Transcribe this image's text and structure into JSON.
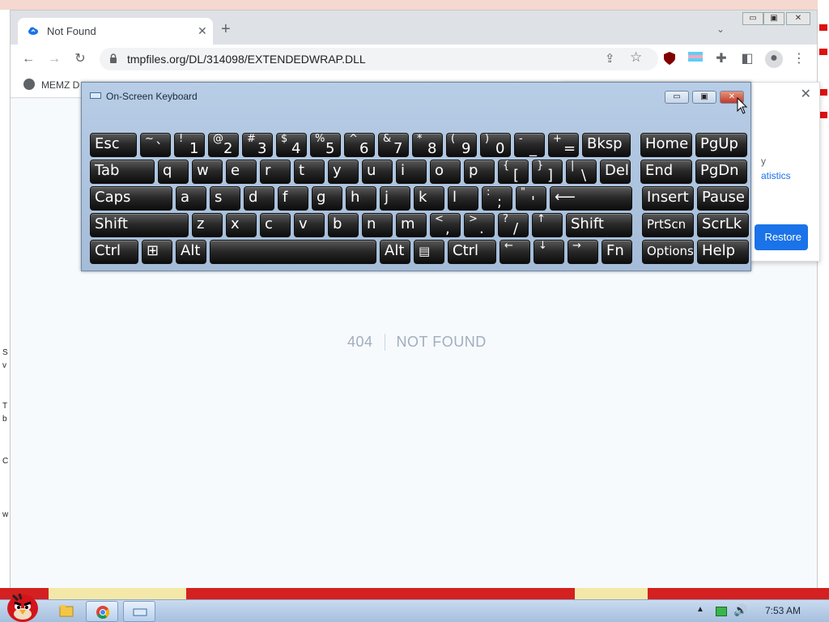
{
  "browser": {
    "tab_title": "Not Found",
    "tab_close": "✕",
    "new_tab": "+",
    "tab_search": "⌄",
    "url": "tmpfiles.org/DL/314098/EXTENDEDWRAP.DLL",
    "bookmark": "MEMZ D",
    "window_controls": [
      "▭",
      "▣",
      "✕"
    ]
  },
  "page": {
    "code": "404",
    "message": "NOT FOUND"
  },
  "popup": {
    "line1": "y",
    "line2": "atistics",
    "close": "✕",
    "restore_label": "Restore"
  },
  "osk": {
    "title": "On-Screen Keyboard",
    "controls": [
      "▭",
      "▣",
      "✕"
    ],
    "rows": [
      [
        {
          "m": "Esc",
          "w": 58
        },
        {
          "s": "~",
          "p": "`",
          "w": 38
        },
        {
          "s": "!",
          "p": "1",
          "w": 38
        },
        {
          "s": "@",
          "p": "2",
          "w": 38
        },
        {
          "s": "#",
          "p": "3",
          "w": 38
        },
        {
          "s": "$",
          "p": "4",
          "w": 38
        },
        {
          "s": "%",
          "p": "5",
          "w": 38
        },
        {
          "s": "^",
          "p": "6",
          "w": 38
        },
        {
          "s": "&",
          "p": "7",
          "w": 38
        },
        {
          "s": "*",
          "p": "8",
          "w": 38
        },
        {
          "s": "(",
          "p": "9",
          "w": 38
        },
        {
          "s": ")",
          "p": "0",
          "w": 38
        },
        {
          "s": "-",
          "p": "_",
          "w": 38
        },
        {
          "s": "+",
          "p": "=",
          "w": 38
        },
        {
          "m": "Bksp",
          "w": 60
        },
        {
          "m": "Home",
          "w": 64,
          "gap": 8
        },
        {
          "m": "PgUp",
          "w": 64
        }
      ],
      [
        {
          "m": "Tab",
          "w": 80
        },
        {
          "m": "q",
          "w": 38
        },
        {
          "m": "w",
          "w": 38
        },
        {
          "m": "e",
          "w": 38
        },
        {
          "m": "r",
          "w": 38
        },
        {
          "m": "t",
          "w": 38
        },
        {
          "m": "y",
          "w": 38
        },
        {
          "m": "u",
          "w": 38
        },
        {
          "m": "i",
          "w": 38
        },
        {
          "m": "o",
          "w": 38
        },
        {
          "m": "p",
          "w": 38
        },
        {
          "s": "{",
          "p": "[",
          "w": 38
        },
        {
          "s": "}",
          "p": "]",
          "w": 38
        },
        {
          "s": "|",
          "p": "\\",
          "w": 38
        },
        {
          "m": "Del",
          "w": 38
        },
        {
          "m": "End",
          "w": 64,
          "gap": 8
        },
        {
          "m": "PgDn",
          "w": 64
        }
      ],
      [
        {
          "m": "Caps",
          "w": 102
        },
        {
          "m": "a",
          "w": 38
        },
        {
          "m": "s",
          "w": 38
        },
        {
          "m": "d",
          "w": 38
        },
        {
          "m": "f",
          "w": 38
        },
        {
          "m": "g",
          "w": 38
        },
        {
          "m": "h",
          "w": 38
        },
        {
          "m": "j",
          "w": 38
        },
        {
          "m": "k",
          "w": 38
        },
        {
          "m": "l",
          "w": 38
        },
        {
          "s": ":",
          "p": ";",
          "w": 38
        },
        {
          "s": "\"",
          "p": "'",
          "w": 38
        },
        {
          "m": "⟵",
          "w": 102
        },
        {
          "m": "Insert",
          "w": 64,
          "gap": 8
        },
        {
          "m": "Pause",
          "w": 64
        }
      ],
      [
        {
          "m": "Shift",
          "w": 122
        },
        {
          "m": "z",
          "w": 38
        },
        {
          "m": "x",
          "w": 38
        },
        {
          "m": "c",
          "w": 38
        },
        {
          "m": "v",
          "w": 38
        },
        {
          "m": "b",
          "w": 38
        },
        {
          "m": "n",
          "w": 38
        },
        {
          "m": "m",
          "w": 38
        },
        {
          "s": "<",
          "p": ",",
          "w": 38
        },
        {
          "s": ">",
          "p": ".",
          "w": 38
        },
        {
          "s": "?",
          "p": "/",
          "w": 38
        },
        {
          "s": "↑",
          "w": 38
        },
        {
          "m": "Shift",
          "w": 82
        },
        {
          "m": "PrtScn",
          "w": 64,
          "gap": 8,
          "small": true
        },
        {
          "m": "ScrLk",
          "w": 64
        }
      ],
      [
        {
          "m": "Ctrl",
          "w": 60
        },
        {
          "m": "⊞",
          "w": 38
        },
        {
          "m": "Alt",
          "w": 38
        },
        {
          "m": "",
          "w": 206
        },
        {
          "m": "Alt",
          "w": 38
        },
        {
          "m": "▤",
          "w": 38,
          "small": true
        },
        {
          "m": "Ctrl",
          "w": 60
        },
        {
          "s": "←",
          "w": 38
        },
        {
          "s": "↓",
          "w": 38
        },
        {
          "s": "→",
          "w": 38
        },
        {
          "m": "Fn",
          "w": 38
        },
        {
          "m": "Options",
          "w": 64,
          "gap": 8,
          "small": true
        },
        {
          "m": "Help",
          "w": 64
        }
      ]
    ]
  },
  "desktop": {
    "left_chars": [
      "S",
      "v",
      "T",
      "b",
      "C",
      "w"
    ]
  },
  "taskbar": {
    "tray_expand": "▲",
    "volume": "🔊",
    "time": "7:53 AM"
  },
  "colors": {
    "accent": "#1a73e8",
    "key_bg": "#1e1e1e"
  }
}
